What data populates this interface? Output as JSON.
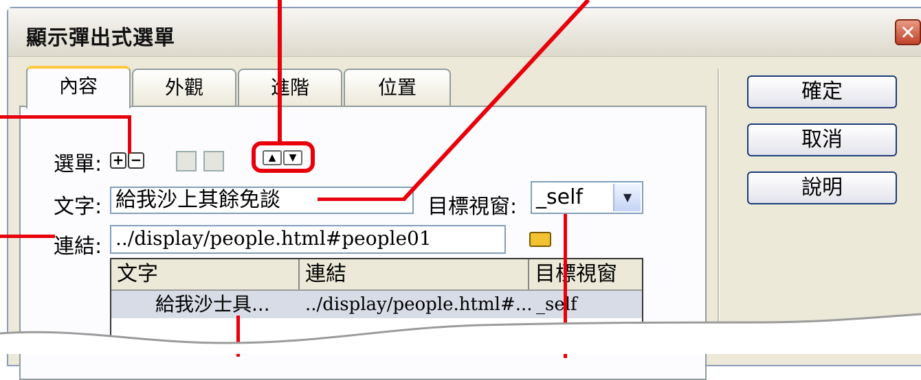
{
  "dialog": {
    "title": "顯示彈出式選單"
  },
  "tabs": [
    {
      "label": "內容",
      "active": true
    },
    {
      "label": "外觀",
      "active": false
    },
    {
      "label": "進階",
      "active": false
    },
    {
      "label": "位置",
      "active": false
    }
  ],
  "buttons": {
    "ok": "確定",
    "cancel": "取消",
    "help": "說明"
  },
  "menu": {
    "label": "選單:",
    "add": "+",
    "remove": "−"
  },
  "text_field": {
    "label": "文字:",
    "value": "給我沙上其餘免談"
  },
  "target": {
    "label": "目標視窗:",
    "value": "_self"
  },
  "link_field": {
    "label": "連結:",
    "value": "../display/people.html#people01"
  },
  "table": {
    "headers": [
      "文字",
      "連結",
      "目標視窗"
    ],
    "rows": [
      [
        "給我沙士具...",
        "../display/people.html#...",
        "_self"
      ]
    ]
  },
  "colors": {
    "highlight": "#e8000b",
    "accent_tab": "#ffc83c"
  }
}
